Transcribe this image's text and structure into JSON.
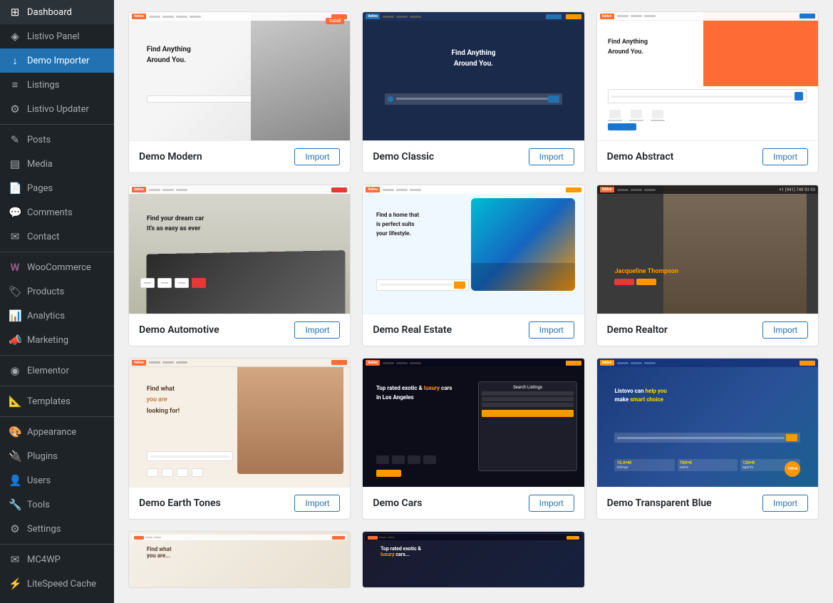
{
  "sidebar": {
    "items": [
      {
        "id": "dashboard",
        "label": "Dashboard",
        "icon": "⊞"
      },
      {
        "id": "listivo-panel",
        "label": "Listivo Panel",
        "icon": "◈"
      },
      {
        "id": "demo-importer",
        "label": "Demo Importer",
        "icon": "↓",
        "active": true
      },
      {
        "id": "listings",
        "label": "Listings",
        "icon": "≡"
      },
      {
        "id": "listivo-updater",
        "label": "Listivo Updater",
        "icon": "⚙"
      },
      {
        "id": "posts",
        "label": "Posts",
        "icon": "✎"
      },
      {
        "id": "media",
        "label": "Media",
        "icon": "🎵"
      },
      {
        "id": "pages",
        "label": "Pages",
        "icon": "📄"
      },
      {
        "id": "comments",
        "label": "Comments",
        "icon": "💬"
      },
      {
        "id": "contact",
        "label": "Contact",
        "icon": "✉"
      },
      {
        "id": "woocommerce",
        "label": "WooCommerce",
        "icon": "W"
      },
      {
        "id": "products",
        "label": "Products",
        "icon": "🛍"
      },
      {
        "id": "analytics",
        "label": "Analytics",
        "icon": "📊"
      },
      {
        "id": "marketing",
        "label": "Marketing",
        "icon": "📣"
      },
      {
        "id": "elementor",
        "label": "Elementor",
        "icon": "◉"
      },
      {
        "id": "templates",
        "label": "Templates",
        "icon": "📐"
      },
      {
        "id": "appearance",
        "label": "Appearance",
        "icon": "🎨"
      },
      {
        "id": "plugins",
        "label": "Plugins",
        "icon": "🔌"
      },
      {
        "id": "users",
        "label": "Users",
        "icon": "👤"
      },
      {
        "id": "tools",
        "label": "Tools",
        "icon": "🔧"
      },
      {
        "id": "settings",
        "label": "Settings",
        "icon": "⚙"
      },
      {
        "id": "mc4wp",
        "label": "MC4WP",
        "icon": "✉"
      },
      {
        "id": "litespeed-cache",
        "label": "LiteSpeed Cache",
        "icon": "⚡"
      }
    ]
  },
  "demos": [
    {
      "id": "modern",
      "title": "Demo Modern",
      "import_label": "Import",
      "theme": "modern"
    },
    {
      "id": "classic",
      "title": "Demo Classic",
      "import_label": "Import",
      "theme": "classic"
    },
    {
      "id": "abstract",
      "title": "Demo Abstract",
      "import_label": "Import",
      "theme": "abstract"
    },
    {
      "id": "automotive",
      "title": "Demo Automotive",
      "import_label": "Import",
      "theme": "automotive"
    },
    {
      "id": "real-estate",
      "title": "Demo Real Estate",
      "import_label": "Import",
      "theme": "realestate"
    },
    {
      "id": "realtor",
      "title": "Demo Realtor",
      "import_label": "Import",
      "theme": "realtor"
    },
    {
      "id": "earth-tones",
      "title": "Demo Earth Tones",
      "import_label": "Import",
      "theme": "earth"
    },
    {
      "id": "cars",
      "title": "Demo Cars",
      "import_label": "Import",
      "theme": "cars"
    },
    {
      "id": "transparent-blue",
      "title": "Demo Transparent Blue",
      "import_label": "Import",
      "theme": "blue"
    }
  ]
}
